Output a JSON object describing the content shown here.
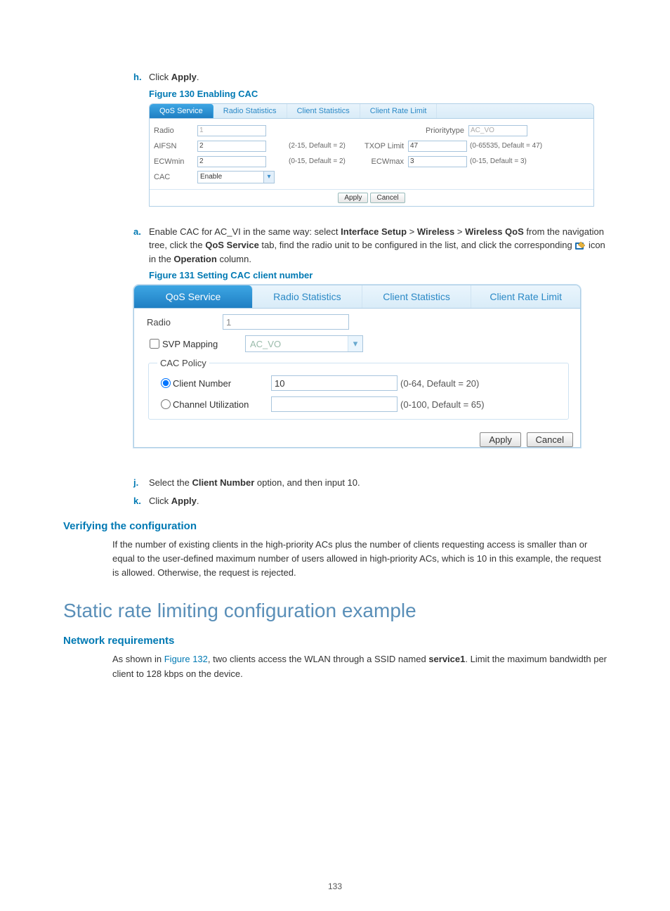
{
  "steps": {
    "h": {
      "marker": "h.",
      "prefix": "Click ",
      "bold": "Apply",
      "suffix": "."
    },
    "a": {
      "marker": "a.",
      "text_before": "Enable CAC for AC_VI in the same way: select ",
      "b1": "Interface Setup",
      "sep1": " > ",
      "b2": "Wireless",
      "sep2": " > ",
      "b3": "Wireless QoS",
      "mid1": " from the navigation tree, click the ",
      "b4": "QoS Service",
      "mid2": " tab, find the radio unit to be configured in the list, and click the corresponding ",
      "mid3": " icon in the ",
      "b5": "Operation",
      "mid4": " column."
    },
    "j": {
      "marker": "j.",
      "prefix": "Select the ",
      "bold": "Client Number",
      "suffix": " option, and then input 10."
    },
    "k": {
      "marker": "k.",
      "prefix": "Click ",
      "bold": "Apply",
      "suffix": "."
    }
  },
  "figures": {
    "f130": {
      "title": "Figure 130 Enabling CAC"
    },
    "f131": {
      "title": "Figure 131 Setting CAC client number"
    }
  },
  "fig130": {
    "tabs": {
      "qos": "QoS Service",
      "radio_stats": "Radio Statistics",
      "client_stats": "Client Statistics",
      "rate_limit": "Client Rate Limit"
    },
    "rows": {
      "radio": {
        "label": "Radio",
        "value": "1",
        "label2": "Prioritytype",
        "value2": "AC_VO"
      },
      "aifsn": {
        "label": "AIFSN",
        "value": "2",
        "hint": "(2-15, Default = 2)",
        "label2": "TXOP Limit",
        "value2": "47",
        "hint2": "(0-65535, Default = 47)"
      },
      "ecwmin": {
        "label": "ECWmin",
        "value": "2",
        "hint": "(0-15, Default = 2)",
        "label2": "ECWmax",
        "value2": "3",
        "hint2": "(0-15, Default = 3)"
      },
      "cac": {
        "label": "CAC",
        "value": "Enable"
      }
    },
    "buttons": {
      "apply": "Apply",
      "cancel": "Cancel"
    }
  },
  "fig131": {
    "tabs": {
      "qos": "QoS Service",
      "radio_stats": "Radio Statistics",
      "client_stats": "Client Statistics",
      "rate_limit": "Client Rate Limit"
    },
    "radio": {
      "label": "Radio",
      "value": "1"
    },
    "svp": {
      "label": "SVP Mapping",
      "value": "AC_VO"
    },
    "legend": "CAC Policy",
    "client_number": {
      "label": "Client Number",
      "value": "10",
      "hint": "(0-64, Default = 20)"
    },
    "channel_util": {
      "label": "Channel Utilization",
      "value": "",
      "hint": "(0-100, Default = 65)"
    },
    "buttons": {
      "apply": "Apply",
      "cancel": "Cancel"
    }
  },
  "sections": {
    "verify": {
      "heading": "Verifying the configuration",
      "para": "If the number of existing clients in the high-priority ACs plus the number of clients requesting access is smaller than or equal to the user-defined maximum number of users allowed in high-priority ACs, which is 10 in this example, the request is allowed. Otherwise, the request is rejected."
    },
    "static_rate": {
      "heading": "Static rate limiting configuration example"
    },
    "net_req": {
      "heading": "Network requirements",
      "p_before": "As shown in ",
      "link": "Figure 132",
      "p_mid": ", two clients access the WLAN through a SSID named ",
      "bold": "service1",
      "p_after": ". Limit the maximum bandwidth per client to 128 kbps on the device."
    }
  },
  "page_number": "133"
}
